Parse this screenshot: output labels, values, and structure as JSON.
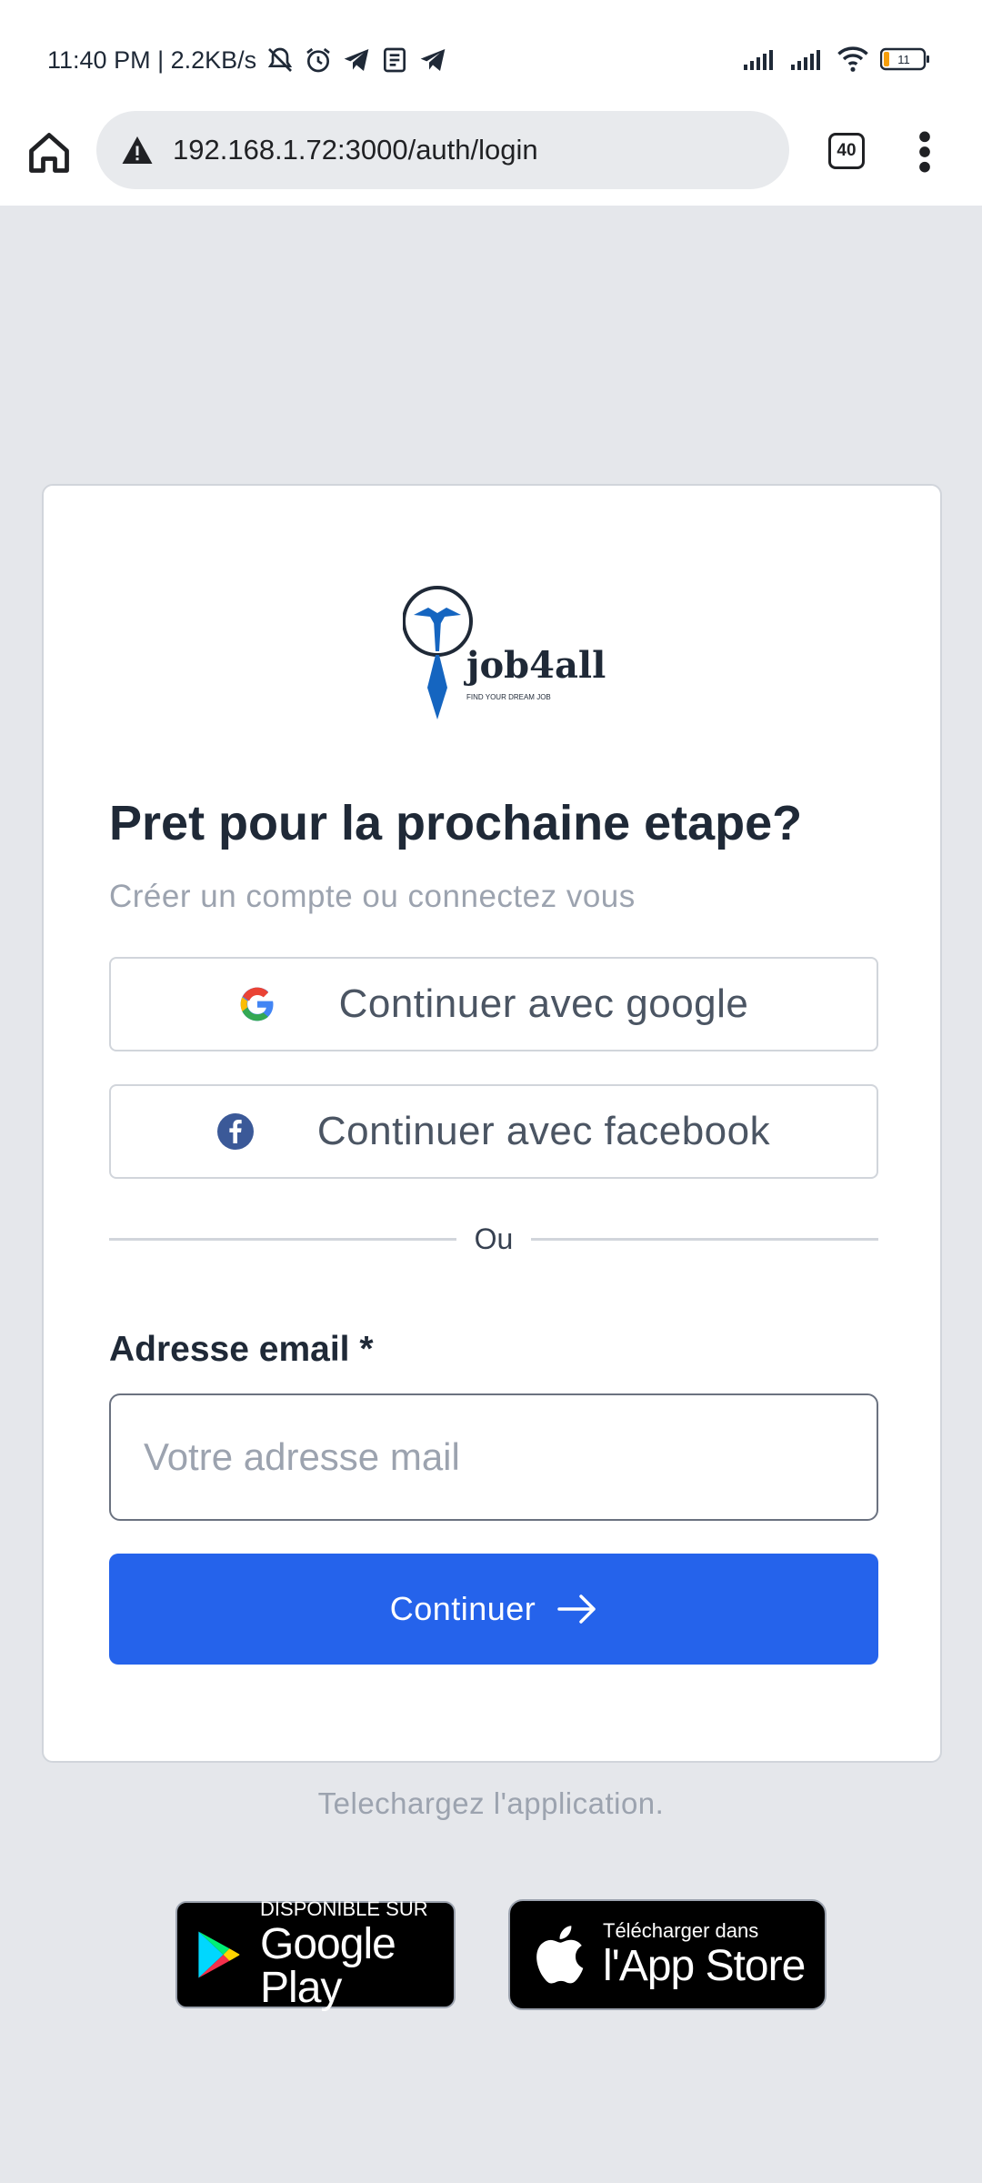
{
  "status_bar": {
    "time_network": "11:40 PM | 2.2KB/s",
    "battery": "11"
  },
  "browser": {
    "url": "192.168.1.72:3000/auth/login",
    "tab_count": "40"
  },
  "logo": {
    "name": "job4all",
    "tagline": "FIND YOUR DREAM JOB"
  },
  "login": {
    "heading": "Pret pour la prochaine etape?",
    "subheading": "Créer un compte ou connectez vous",
    "google_button": "Continuer avec google",
    "facebook_button": "Continuer avec facebook",
    "divider": "Ou",
    "email_label": "Adresse email *",
    "email_placeholder": "Votre adresse mail",
    "email_value": "",
    "continue_button": "Continuer"
  },
  "download": {
    "text": "Telechargez l'application.",
    "google_play_small": "DISPONIBLE SUR",
    "google_play_big": "Google Play",
    "app_store_small": "Télécharger dans",
    "app_store_big": "l'App Store"
  },
  "colors": {
    "primary": "#2563eb",
    "background": "#e5e7eb",
    "logo_blue": "#1565c0"
  }
}
